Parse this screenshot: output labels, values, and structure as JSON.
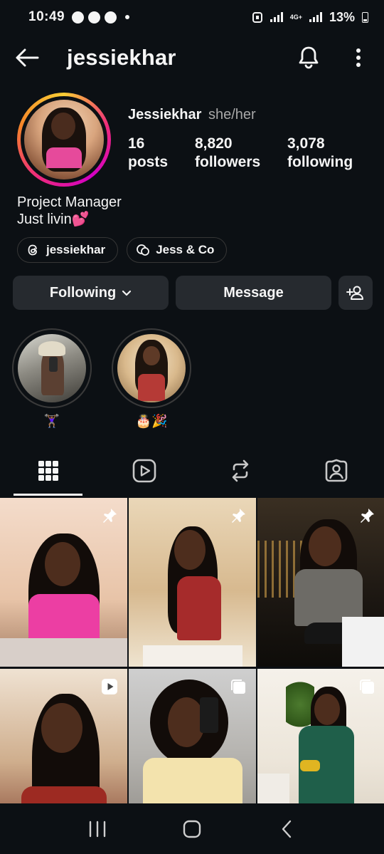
{
  "status_bar": {
    "time": "10:49",
    "network_label": "4G+",
    "battery": "13%"
  },
  "header": {
    "username": "jessiekhar"
  },
  "profile": {
    "name": "Jessiekhar",
    "pronouns": "she/her",
    "stats": {
      "posts_count": "16",
      "posts_label": "posts",
      "followers_count": "8,820",
      "followers_label": "followers",
      "following_count": "3,078",
      "following_label": "following"
    },
    "bio_line1": "Project Manager",
    "bio_line2": "Just livin💕",
    "threads_handle": "jessiekhar",
    "channel_name": "Jess & Co"
  },
  "actions": {
    "following_label": "Following",
    "message_label": "Message"
  },
  "highlights": [
    {
      "label": "🏋🏾‍♀️"
    },
    {
      "label": "🎂🎉"
    }
  ],
  "tabs": [
    {
      "icon": "grid-icon",
      "active": true
    },
    {
      "icon": "reels-icon",
      "active": false
    },
    {
      "icon": "reposts-icon",
      "active": false
    },
    {
      "icon": "tagged-icon",
      "active": false
    }
  ],
  "grid": [
    {
      "badge": "pin-icon"
    },
    {
      "badge": "pin-icon"
    },
    {
      "badge": "pin-icon"
    },
    {
      "badge": "reel-icon"
    },
    {
      "badge": "carousel-icon"
    },
    {
      "badge": "carousel-icon"
    }
  ],
  "colors": {
    "background": "#0c1014",
    "button": "#262a2f",
    "text": "#f5f5f5",
    "muted": "#a8a8a8"
  }
}
